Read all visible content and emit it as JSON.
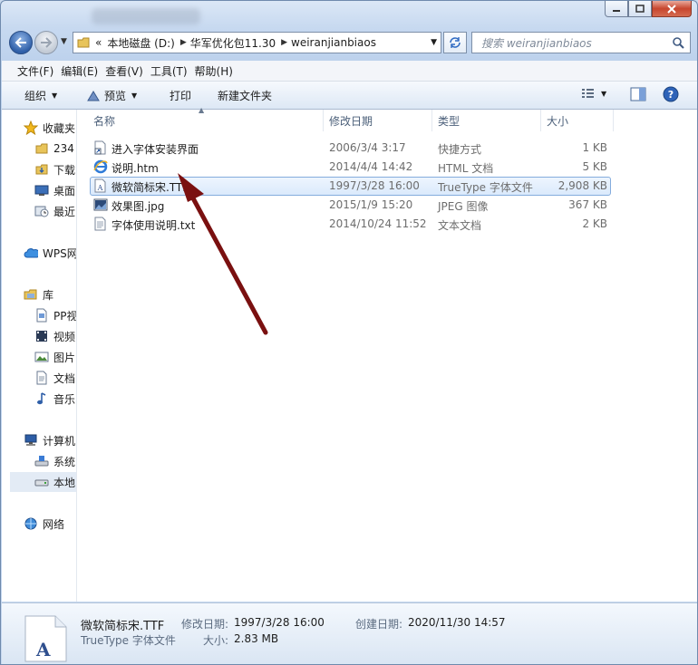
{
  "address": {
    "crumbs": [
      "本地磁盘 (D:)",
      "华军优化包11.30",
      "weiranjianbiaos"
    ],
    "prefix": "«"
  },
  "search": {
    "placeholder": "搜索 weiranjianbiaos"
  },
  "menu": [
    "文件(F)",
    "编辑(E)",
    "查看(V)",
    "工具(T)",
    "帮助(H)"
  ],
  "toolbar": {
    "organize": "组织",
    "preview": "预览",
    "print": "打印",
    "new_folder": "新建文件夹"
  },
  "sidebar": [
    {
      "label": "收藏夹",
      "icon": "star-icon"
    },
    {
      "label": "234",
      "icon": "folder-icon"
    },
    {
      "label": "下载",
      "icon": "download-folder-icon"
    },
    {
      "label": "桌面",
      "icon": "desktop-icon"
    },
    {
      "label": "最近",
      "icon": "recent-places-icon"
    },
    {
      "label": "WPS网",
      "icon": "cloud-icon"
    },
    {
      "label": "库",
      "icon": "library-icon"
    },
    {
      "label": "PP视",
      "icon": "document-icon"
    },
    {
      "label": "视频",
      "icon": "video-icon"
    },
    {
      "label": "图片",
      "icon": "picture-icon"
    },
    {
      "label": "文档",
      "icon": "document-icon"
    },
    {
      "label": "音乐",
      "icon": "music-icon"
    },
    {
      "label": "计算机",
      "icon": "computer-icon"
    },
    {
      "label": "系统",
      "icon": "drive-system-icon"
    },
    {
      "label": "本地",
      "icon": "drive-icon"
    },
    {
      "label": "网络",
      "icon": "network-icon"
    }
  ],
  "columns": {
    "name": "名称",
    "date": "修改日期",
    "type": "类型",
    "size": "大小"
  },
  "files": [
    {
      "name": "进入字体安装界面",
      "date": "2006/3/4 3:17",
      "type": "快捷方式",
      "size": "1 KB",
      "icon": "shortcut-icon"
    },
    {
      "name": "说明.htm",
      "date": "2014/4/4 14:42",
      "type": "HTML 文档",
      "size": "5 KB",
      "icon": "ie-icon"
    },
    {
      "name": "微软简标宋.TTF",
      "date": "1997/3/28 16:00",
      "type": "TrueType 字体文件",
      "size": "2,908 KB",
      "icon": "font-file-icon"
    },
    {
      "name": "效果图.jpg",
      "date": "2015/1/9 15:20",
      "type": "JPEG 图像",
      "size": "367 KB",
      "icon": "image-file-icon"
    },
    {
      "name": "字体使用说明.txt",
      "date": "2014/10/24 11:52",
      "type": "文本文档",
      "size": "2 KB",
      "icon": "text-file-icon"
    }
  ],
  "details": {
    "name": "微软简标宋.TTF",
    "type": "TrueType 字体文件",
    "modified_label": "修改日期:",
    "modified": "1997/3/28 16:00",
    "created_label": "创建日期:",
    "created": "2020/11/30 14:57",
    "size_label": "大小:",
    "size": "2.83 MB"
  },
  "colors": {
    "accent": "#2f5fa8",
    "selection": "#dbeafc",
    "arrow": "#7a1010"
  }
}
